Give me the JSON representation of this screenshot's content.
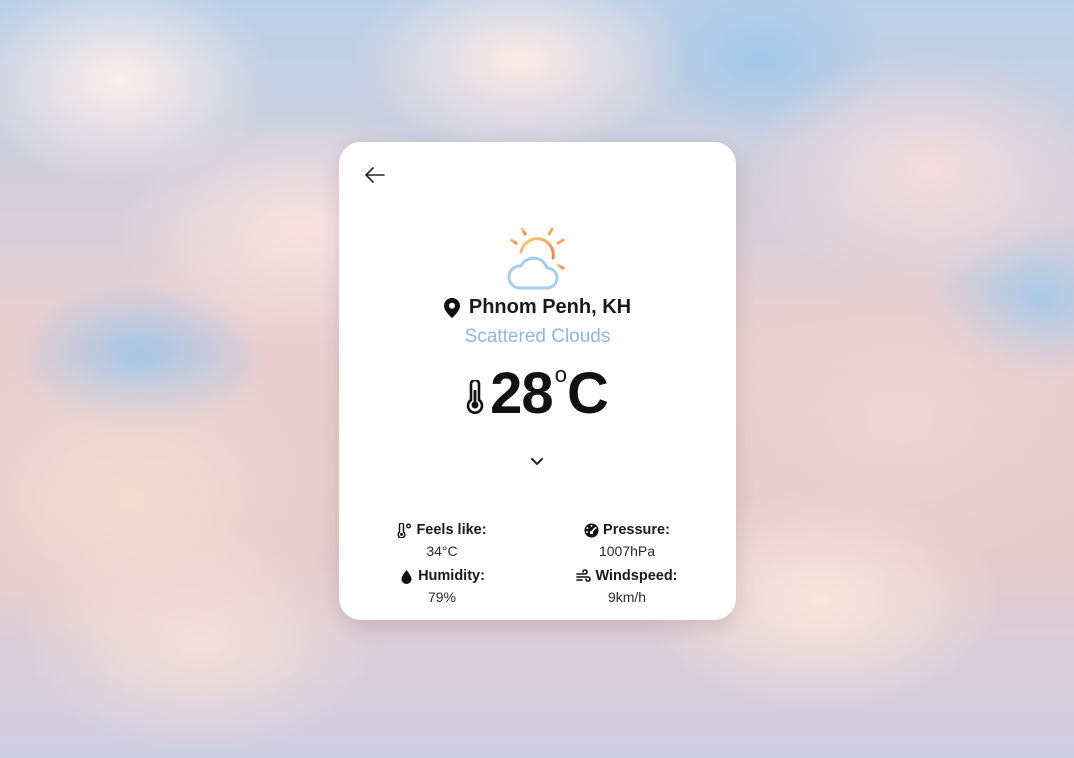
{
  "weather": {
    "location": "Phnom Penh, KH",
    "description": "Scattered Clouds",
    "temperature": "28",
    "degree_symbol": "o",
    "unit": "C",
    "condition_icon": "partly-cloudy-sun-icon"
  },
  "details": {
    "feels_like_label": "Feels like:",
    "feels_like_value": "34°C",
    "pressure_label": "Pressure:",
    "pressure_value": "1007hPa",
    "humidity_label": "Humidity:",
    "humidity_value": "79%",
    "windspeed_label": "Windspeed:",
    "windspeed_value": "9km/h"
  },
  "colors": {
    "description_text": "#8fb8df",
    "card_background": "#ffffff",
    "sun_gradient_start": "#f5c36a",
    "sun_gradient_end": "#e88a5c",
    "cloud_stroke": "#a9cdef"
  }
}
